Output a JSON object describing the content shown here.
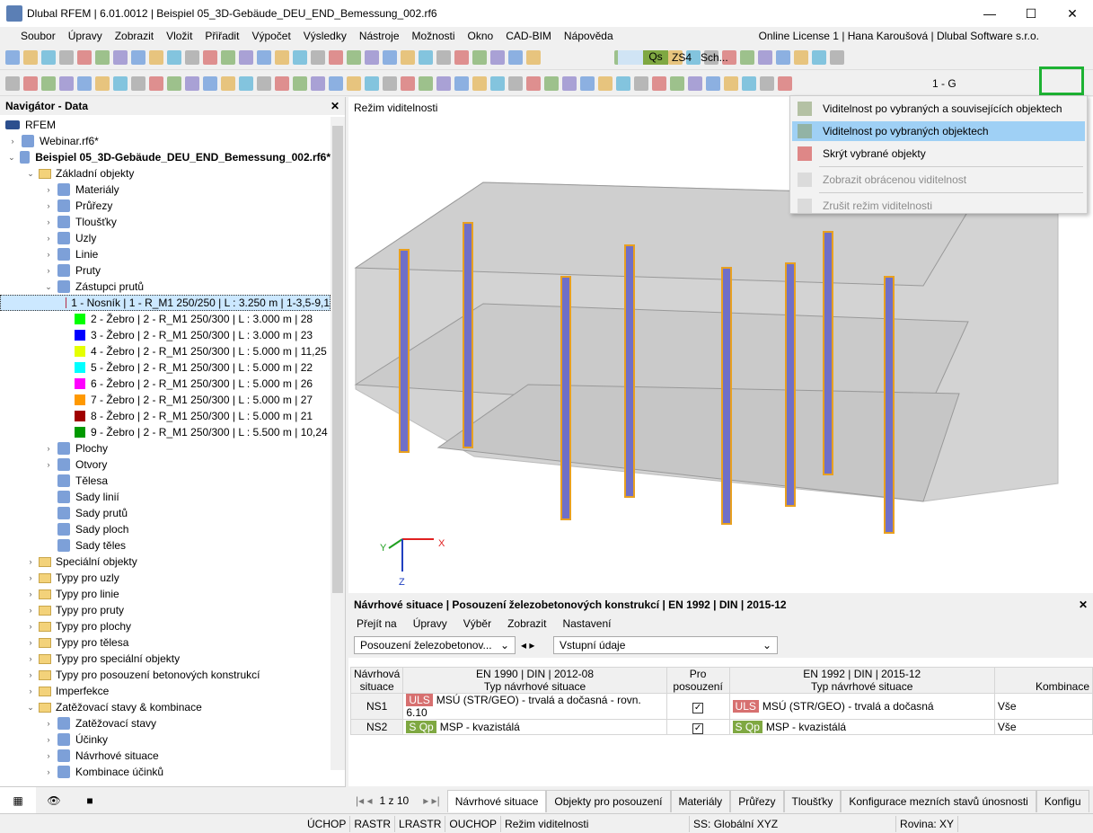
{
  "window": {
    "title": "Dlubal RFEM | 6.01.0012 | Beispiel 05_3D-Gebäude_DEU_END_Bemessung_002.rf6",
    "minimize": "—",
    "maximize": "☐",
    "close": "✕"
  },
  "menu": [
    "Soubor",
    "Úpravy",
    "Zobrazit",
    "Vložit",
    "Přiřadit",
    "Výpočet",
    "Výsledky",
    "Nástroje",
    "Možnosti",
    "Okno",
    "CAD-BIM",
    "Nápověda"
  ],
  "license": "Online License 1 | Hana Karoušová | Dlubal Software s.r.o.",
  "toolbar": {
    "loadcase_code": "Qs",
    "loadcase": "ZS4",
    "loadcase_name": "Sch...",
    "coord": "1 - G"
  },
  "navigator": {
    "title": "Navigátor - Data",
    "root": "RFEM",
    "items": [
      {
        "level": 0,
        "label": "Webinar.rf6*",
        "exp": "›"
      },
      {
        "level": 0,
        "label": "Beispiel 05_3D-Gebäude_DEU_END_Bemessung_002.rf6*",
        "exp": "⌄",
        "bold": true
      },
      {
        "level": 1,
        "label": "Základní objekty",
        "exp": "⌄",
        "folder": true
      },
      {
        "level": 2,
        "label": "Materiály",
        "exp": "›"
      },
      {
        "level": 2,
        "label": "Průřezy",
        "exp": "›"
      },
      {
        "level": 2,
        "label": "Tloušťky",
        "exp": "›"
      },
      {
        "level": 2,
        "label": "Uzly",
        "exp": "›"
      },
      {
        "level": 2,
        "label": "Linie",
        "exp": "›"
      },
      {
        "level": 2,
        "label": "Pruty",
        "exp": "›"
      },
      {
        "level": 2,
        "label": "Zástupci prutů",
        "exp": "⌄"
      },
      {
        "level": 3,
        "label": "1 - Nosník | 1 - R_M1 250/250 | L : 3.250 m | 1-3,5-9,1",
        "color": "#b22a47",
        "selected": true
      },
      {
        "level": 3,
        "label": "2 - Žebro | 2 - R_M1 250/300 | L : 3.000 m | 28",
        "color": "#00ff00"
      },
      {
        "level": 3,
        "label": "3 - Žebro | 2 - R_M1 250/300 | L : 3.000 m | 23",
        "color": "#0000ff"
      },
      {
        "level": 3,
        "label": "4 - Žebro | 2 - R_M1 250/300 | L : 5.000 m | 11,25",
        "color": "#e5ff00"
      },
      {
        "level": 3,
        "label": "5 - Žebro | 2 - R_M1 250/300 | L : 5.000 m | 22",
        "color": "#00ffff"
      },
      {
        "level": 3,
        "label": "6 - Žebro | 2 - R_M1 250/300 | L : 5.000 m | 26",
        "color": "#ff00ff"
      },
      {
        "level": 3,
        "label": "7 - Žebro | 2 - R_M1 250/300 | L : 5.000 m | 27",
        "color": "#ff9900"
      },
      {
        "level": 3,
        "label": "8 - Žebro | 2 - R_M1 250/300 | L : 5.000 m | 21",
        "color": "#a00000"
      },
      {
        "level": 3,
        "label": "9 - Žebro | 2 - R_M1 250/300 | L : 5.500 m | 10,24",
        "color": "#009900"
      },
      {
        "level": 2,
        "label": "Plochy",
        "exp": "›"
      },
      {
        "level": 2,
        "label": "Otvory",
        "exp": "›"
      },
      {
        "level": 2,
        "label": "Tělesa",
        "exp": ""
      },
      {
        "level": 2,
        "label": "Sady linií",
        "exp": ""
      },
      {
        "level": 2,
        "label": "Sady prutů",
        "exp": ""
      },
      {
        "level": 2,
        "label": "Sady ploch",
        "exp": ""
      },
      {
        "level": 2,
        "label": "Sady těles",
        "exp": ""
      },
      {
        "level": 1,
        "label": "Speciální objekty",
        "exp": "›",
        "folder": true
      },
      {
        "level": 1,
        "label": "Typy pro uzly",
        "exp": "›",
        "folder": true
      },
      {
        "level": 1,
        "label": "Typy pro linie",
        "exp": "›",
        "folder": true
      },
      {
        "level": 1,
        "label": "Typy pro pruty",
        "exp": "›",
        "folder": true
      },
      {
        "level": 1,
        "label": "Typy pro plochy",
        "exp": "›",
        "folder": true
      },
      {
        "level": 1,
        "label": "Typy pro tělesa",
        "exp": "›",
        "folder": true
      },
      {
        "level": 1,
        "label": "Typy pro speciální objekty",
        "exp": "›",
        "folder": true
      },
      {
        "level": 1,
        "label": "Typy pro posouzení betonových konstrukcí",
        "exp": "›",
        "folder": true
      },
      {
        "level": 1,
        "label": "Imperfekce",
        "exp": "›",
        "folder": true
      },
      {
        "level": 1,
        "label": "Zatěžovací stavy & kombinace",
        "exp": "⌄",
        "folder": true
      },
      {
        "level": 2,
        "label": "Zatěžovací stavy",
        "exp": "›"
      },
      {
        "level": 2,
        "label": "Účinky",
        "exp": "›"
      },
      {
        "level": 2,
        "label": "Návrhové situace",
        "exp": "›"
      },
      {
        "level": 2,
        "label": "Kombinace účinků",
        "exp": "›"
      }
    ]
  },
  "viewport": {
    "label": "Režim viditelnosti",
    "axes": {
      "x": "X",
      "y": "Y",
      "z": "Z"
    }
  },
  "dropdown": [
    {
      "label": "Viditelnost po vybraných a souvisejících objektech",
      "state": "normal"
    },
    {
      "label": "Viditelnost po vybraných objektech",
      "state": "highlighted"
    },
    {
      "label": "Skrýt vybrané objekty",
      "state": "normal"
    },
    {
      "label": "Zobrazit obrácenou viditelnost",
      "state": "disabled"
    },
    {
      "label": "Zrušit režim viditelnosti",
      "state": "disabled"
    }
  ],
  "panel": {
    "title": "Návrhové situace | Posouzení železobetonových konstrukcí | EN 1992 | DIN | 2015-12",
    "menu": [
      "Přejít na",
      "Úpravy",
      "Výběr",
      "Zobrazit",
      "Nastavení"
    ],
    "combo1": "Posouzení železobetonov...",
    "combo2": "Vstupní údaje",
    "headers": {
      "c1": "Návrhová situace",
      "c2a": "EN 1990 | DIN | 2012-08",
      "c2b": "Typ návrhové situace",
      "c3": "Pro posouzení",
      "c4a": "EN 1992 | DIN | 2015-12",
      "c4b": "Typ návrhové situace",
      "c5": "Kombinace"
    },
    "rows": [
      {
        "id": "NS1",
        "badge": "ULS",
        "type1": "MSÚ (STR/GEO) - trvalá a dočasná - rovn. 6.10",
        "checked": true,
        "type2": "MSÚ (STR/GEO) - trvalá a dočasná",
        "comb": "Vše"
      },
      {
        "id": "NS2",
        "badge": "S Qp",
        "type1": "MSP - kvazistálá",
        "checked": true,
        "type2": "MSP - kvazistálá",
        "comb": "Vše"
      }
    ],
    "pager": "1 z 10",
    "tabs": [
      "Návrhové situace",
      "Objekty pro posouzení",
      "Materiály",
      "Průřezy",
      "Tloušťky",
      "Konfigurace mezních stavů únosnosti",
      "Konfigu"
    ]
  },
  "status": [
    "ÚCHOP",
    "RASTR",
    "LRASTR",
    "OUCHOP",
    "Režim viditelnosti",
    "SS: Globální XYZ",
    "Rovina: XY"
  ]
}
